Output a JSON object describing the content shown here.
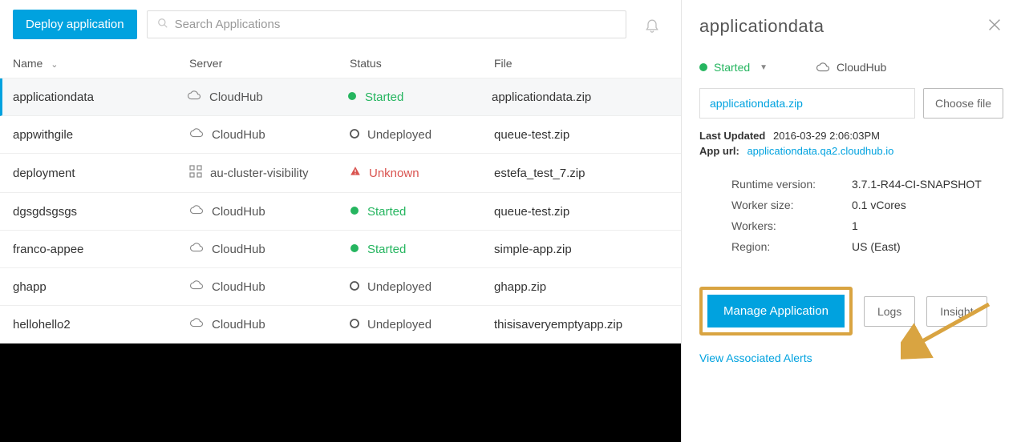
{
  "toolbar": {
    "deploy_label": "Deploy application",
    "search_placeholder": "Search Applications"
  },
  "table": {
    "headers": {
      "name": "Name",
      "server": "Server",
      "status": "Status",
      "file": "File"
    },
    "rows": [
      {
        "name": "applicationdata",
        "server": "CloudHub",
        "server_icon": "cloud",
        "status": "Started",
        "status_kind": "started",
        "file": "applicationdata.zip",
        "selected": true
      },
      {
        "name": "appwithgile",
        "server": "CloudHub",
        "server_icon": "cloud",
        "status": "Undeployed",
        "status_kind": "undeployed",
        "file": "queue-test.zip"
      },
      {
        "name": "deployment",
        "server": "au-cluster-visibility",
        "server_icon": "cluster",
        "status": "Unknown",
        "status_kind": "unknown",
        "file": "estefa_test_7.zip"
      },
      {
        "name": "dgsgdsgsgs",
        "server": "CloudHub",
        "server_icon": "cloud",
        "status": "Started",
        "status_kind": "started",
        "file": "queue-test.zip"
      },
      {
        "name": "franco-appee",
        "server": "CloudHub",
        "server_icon": "cloud",
        "status": "Started",
        "status_kind": "started",
        "file": "simple-app.zip"
      },
      {
        "name": "ghapp",
        "server": "CloudHub",
        "server_icon": "cloud",
        "status": "Undeployed",
        "status_kind": "undeployed",
        "file": "ghapp.zip"
      },
      {
        "name": "hellohello2",
        "server": "CloudHub",
        "server_icon": "cloud",
        "status": "Undeployed",
        "status_kind": "undeployed",
        "file": "thisisaveryemptyapp.zip"
      }
    ]
  },
  "panel": {
    "title": "applicationdata",
    "status": "Started",
    "target": "CloudHub",
    "file": "applicationdata.zip",
    "choose_label": "Choose file",
    "last_updated_label": "Last Updated",
    "last_updated": "2016-03-29 2:06:03PM",
    "app_url_label": "App url:",
    "app_url": "applicationdata.qa2.cloudhub.io",
    "specs": {
      "runtime_label": "Runtime version:",
      "runtime": "3.7.1-R44-CI-SNAPSHOT",
      "worker_size_label": "Worker size:",
      "worker_size": "0.1 vCores",
      "workers_label": "Workers:",
      "workers": "1",
      "region_label": "Region:",
      "region": "US (East)"
    },
    "manage_label": "Manage Application",
    "logs_label": "Logs",
    "insight_label": "Insight",
    "alerts_link": "View Associated Alerts"
  }
}
